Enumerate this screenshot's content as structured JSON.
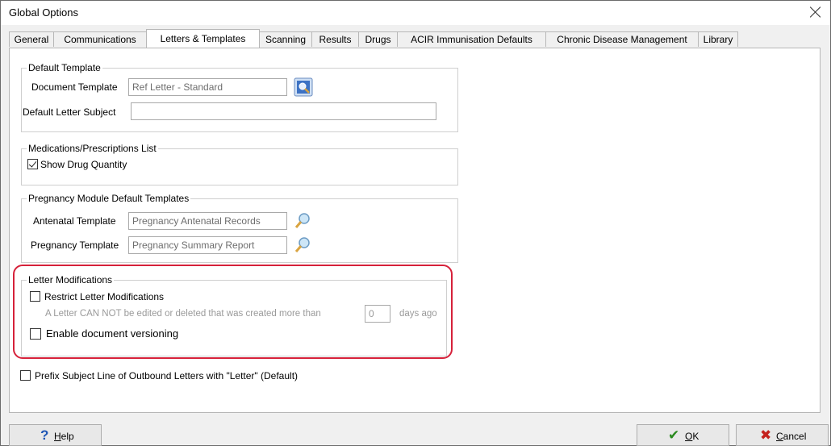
{
  "window": {
    "title": "Global Options"
  },
  "tabs": [
    {
      "label": "General"
    },
    {
      "label": "Communications"
    },
    {
      "label": "Letters & Templates"
    },
    {
      "label": "Scanning"
    },
    {
      "label": "Results"
    },
    {
      "label": "Drugs"
    },
    {
      "label": "ACIR Immunisation Defaults"
    },
    {
      "label": "Chronic Disease Management"
    },
    {
      "label": "Library"
    }
  ],
  "default_template": {
    "title": "Default Template",
    "document_template_label": "Document Template",
    "document_template_value": "Ref Letter - Standard",
    "default_subject_label": "Default Letter Subject",
    "default_subject_value": ""
  },
  "medications": {
    "title": "Medications/Prescriptions List",
    "show_drug_quantity_label": "Show Drug Quantity",
    "show_drug_quantity_checked": true
  },
  "pregnancy": {
    "title": "Pregnancy Module Default Templates",
    "antenatal_label": "Antenatal Template",
    "antenatal_value": "Pregnancy Antenatal Records",
    "pregnancy_label": "Pregnancy Template",
    "pregnancy_value": "Pregnancy Summary Report"
  },
  "letter_mods": {
    "title": "Letter Modifications",
    "restrict_label": "Restrict Letter Modifications",
    "restrict_checked": false,
    "restrict_desc": "A Letter CAN NOT be edited or deleted that was created more than",
    "days_value": "0",
    "days_suffix": "days ago",
    "versioning_label": "Enable document versioning",
    "versioning_checked": false
  },
  "prefix": {
    "label": "Prefix Subject Line of Outbound Letters with \"Letter\" (Default)",
    "checked": false
  },
  "buttons": {
    "help_key": "H",
    "help_rest": "elp",
    "ok_key": "O",
    "ok_rest": "K",
    "cancel_key": "C",
    "cancel_rest": "ancel"
  },
  "colors": {
    "highlight": "#d6213a",
    "ok_icon": "#2a8a1f",
    "cancel_icon": "#c4221d",
    "help_icon": "#1f56b5"
  }
}
